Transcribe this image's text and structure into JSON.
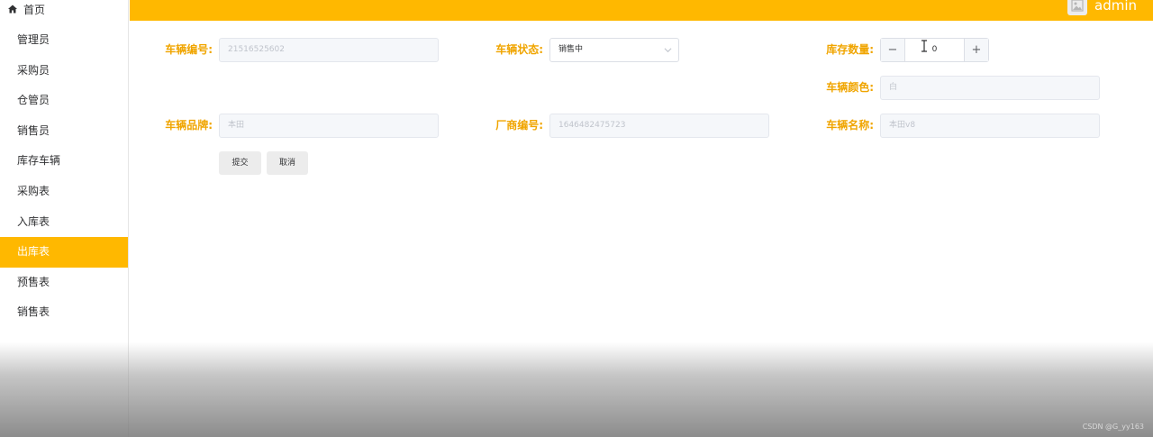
{
  "sidebar": {
    "home_label": "首页",
    "items": [
      {
        "label": "管理员"
      },
      {
        "label": "采购员"
      },
      {
        "label": "仓管员"
      },
      {
        "label": "销售员"
      },
      {
        "label": "库存车辆"
      },
      {
        "label": "采购表"
      },
      {
        "label": "入库表"
      },
      {
        "label": "出库表",
        "active": true
      },
      {
        "label": "预售表"
      },
      {
        "label": "销售表"
      }
    ]
  },
  "header": {
    "username": "admin",
    "bar_color": "#ffb800"
  },
  "form": {
    "vehicle_no_label": "车辆编号:",
    "vehicle_no_value": "21516525602",
    "status_label": "车辆状态:",
    "status_value": "销售中",
    "stock_qty_label": "库存数量:",
    "stock_qty_value": "0",
    "color_label": "车辆颜色:",
    "color_value": "白",
    "brand_label": "车辆品牌:",
    "brand_value": "本田",
    "maker_no_label": "厂商编号:",
    "maker_no_value": "1646482475723",
    "name_label": "车辆名称:",
    "name_value": "本田v8",
    "submit_label": "提交",
    "cancel_label": "取消",
    "label_color": "#f0a500"
  },
  "footer": {
    "watermark": "CSDN @G_yy163"
  }
}
